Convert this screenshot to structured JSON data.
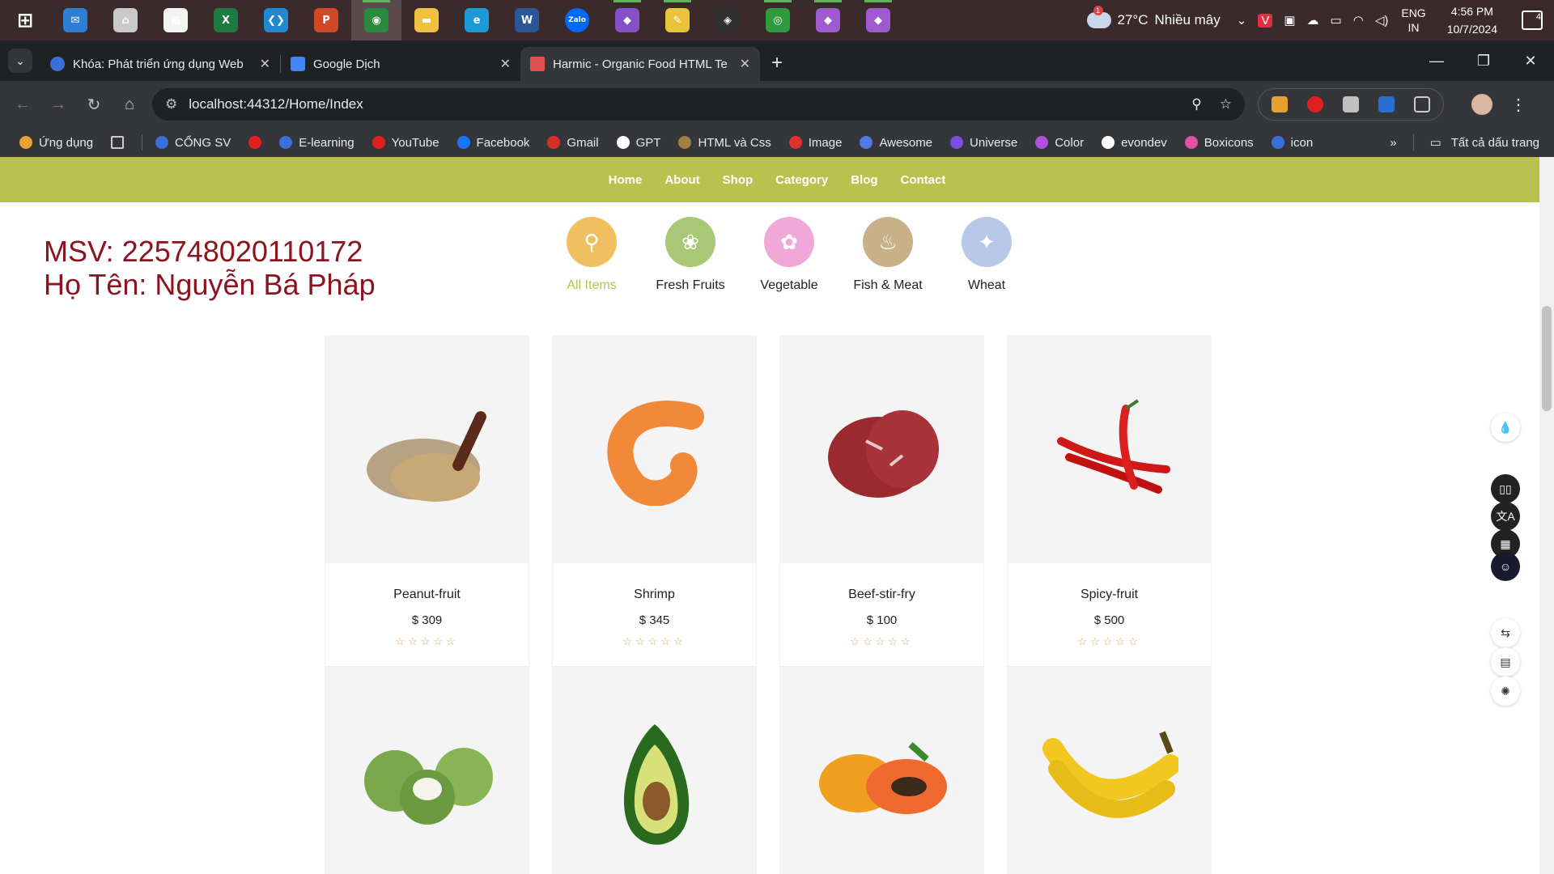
{
  "taskbar": {
    "apps": [
      {
        "name": "windows-start-icon",
        "glyph": "⊞",
        "color": "#3a2a2c"
      },
      {
        "name": "mail-icon",
        "glyph": "✉",
        "color": "#2d7fd6"
      },
      {
        "name": "app-icon",
        "glyph": "⌂",
        "color": "#c9c9c9"
      },
      {
        "name": "store-icon",
        "glyph": "▦",
        "color": "#f3f3f3"
      },
      {
        "name": "excel-icon",
        "glyph": "X",
        "color": "#1e7a43"
      },
      {
        "name": "vscode-icon",
        "glyph": "❮❯",
        "color": "#1f8ad2"
      },
      {
        "name": "powerpoint-icon",
        "glyph": "P",
        "color": "#d24726"
      },
      {
        "name": "chrome-icon",
        "glyph": "◉",
        "color": "#2a8a3e"
      },
      {
        "name": "file-explorer-icon",
        "glyph": "▬",
        "color": "#f0c040"
      },
      {
        "name": "edge-icon",
        "glyph": "e",
        "color": "#1a9bd7"
      },
      {
        "name": "word-icon",
        "glyph": "W",
        "color": "#2b5797"
      },
      {
        "name": "zalo-icon",
        "glyph": "Zalo",
        "color": "#0068ff"
      },
      {
        "name": "visual-studio-icon",
        "glyph": "◆",
        "color": "#8550c8"
      },
      {
        "name": "sticky-app-icon",
        "glyph": "✎",
        "color": "#e9c43a"
      },
      {
        "name": "git-icon",
        "glyph": "◈",
        "color": "#303030"
      },
      {
        "name": "green-app-icon",
        "glyph": "◎",
        "color": "#2f9a3e"
      },
      {
        "name": "visual-studio-preview-icon",
        "glyph": "◆",
        "color": "#a05ad0"
      },
      {
        "name": "visual-studio-preview-2-icon",
        "glyph": "◆",
        "color": "#a05ad0"
      }
    ],
    "weather_temp": "27°C",
    "weather_desc": "Nhiều mây",
    "weather_badge": "1",
    "lang_top": "ENG",
    "lang_bottom": "IN",
    "time": "4:56 PM",
    "date": "10/7/2024",
    "notif_count": "4"
  },
  "tabs": [
    {
      "title": "Khóa: Phát triển ứng dụng Web",
      "color": "#3b6ed8"
    },
    {
      "title": "Google Dịch",
      "color": "#4285f4"
    },
    {
      "title": "Harmic - Organic Food HTML Te",
      "color": "#e05050"
    }
  ],
  "address": {
    "url": "localhost:44312/Home/Index"
  },
  "bookmarks": [
    {
      "label": "Ứng dụng",
      "color": "#e8a030"
    },
    {
      "label": "",
      "color": "#cccccc"
    },
    {
      "label": "CỔNG SV",
      "color": "#3b6ed8"
    },
    {
      "label": "",
      "color": "#e02020"
    },
    {
      "label": "E-learning",
      "color": "#3b6ed8"
    },
    {
      "label": "YouTube",
      "color": "#e02020"
    },
    {
      "label": "Facebook",
      "color": "#1877f2"
    },
    {
      "label": "Gmail",
      "color": "#d93025"
    },
    {
      "label": "GPT",
      "color": "#ffffff"
    },
    {
      "label": "HTML và Css",
      "color": "#a08040"
    },
    {
      "label": "Image",
      "color": "#e03030"
    },
    {
      "label": "Awesome",
      "color": "#4f7ae0"
    },
    {
      "label": "Universe",
      "color": "#7a4fe0"
    },
    {
      "label": "Color",
      "color": "#b04fe0"
    },
    {
      "label": "evondev",
      "color": "#ffffff"
    },
    {
      "label": "Boxicons",
      "color": "#e04fa0"
    },
    {
      "label": "icon",
      "color": "#3b6ed8"
    }
  ],
  "bookmarks_all": "Tất cả dấu trang",
  "nav": [
    "Home",
    "About",
    "Shop",
    "Category",
    "Blog",
    "Contact"
  ],
  "student": {
    "msv": "MSV: 225748020110172",
    "name": "Họ Tên: Nguyễn Bá Pháp"
  },
  "categories": [
    {
      "label": "All Items",
      "color": "#f0c060",
      "glyph": "⚲",
      "icon": "search-food-icon"
    },
    {
      "label": "Fresh Fruits",
      "color": "#a8c878",
      "glyph": "❀",
      "icon": "fruit-icon"
    },
    {
      "label": "Vegetable",
      "color": "#f0a8d8",
      "glyph": "✿",
      "icon": "vegetable-icon"
    },
    {
      "label": "Fish & Meat",
      "color": "#c8b088",
      "glyph": "♨",
      "icon": "meat-icon"
    },
    {
      "label": "Wheat",
      "color": "#b8c8e8",
      "glyph": "✦",
      "icon": "wheat-icon"
    }
  ],
  "products": [
    {
      "name": "Peanut-fruit",
      "price": "$ 309",
      "icon": "grain-sack-icon"
    },
    {
      "name": "Shrimp",
      "price": "$ 345",
      "icon": "shrimp-icon"
    },
    {
      "name": "Beef-stir-fry",
      "price": "$ 100",
      "icon": "beef-icon"
    },
    {
      "name": "Spicy-fruit",
      "price": "$ 500",
      "icon": "chili-icon"
    },
    {
      "name": "",
      "price": "",
      "icon": "coconut-icon"
    },
    {
      "name": "",
      "price": "",
      "icon": "avocado-icon"
    },
    {
      "name": "",
      "price": "",
      "icon": "papaya-icon"
    },
    {
      "name": "",
      "price": "",
      "icon": "banana-icon"
    }
  ],
  "stars": "☆☆☆☆☆"
}
